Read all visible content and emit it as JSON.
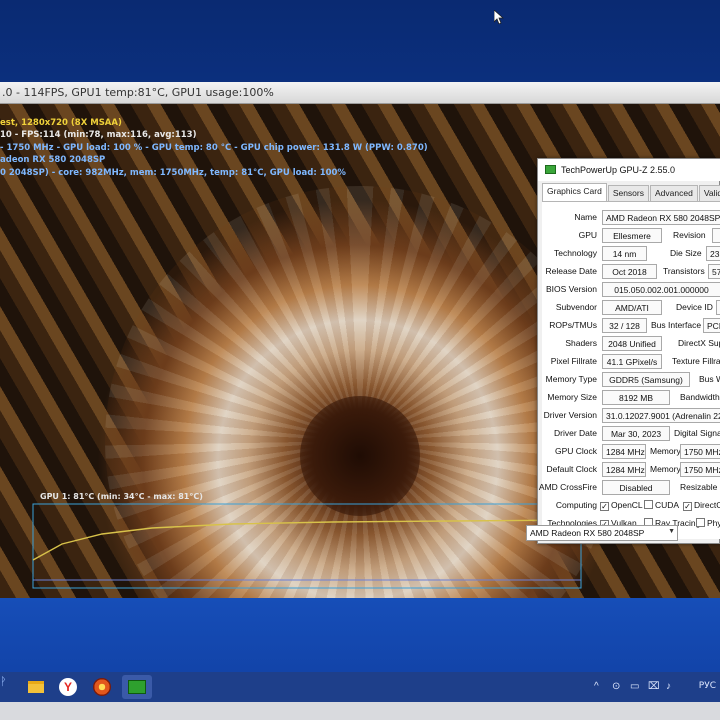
{
  "furmark": {
    "title": ".0 - 114FPS, GPU1 temp:81°C, GPU1 usage:100%",
    "osd": {
      "line1": "est, 1280x720 (8X MSAA)",
      "line2": "10 - FPS:114 (min:78, max:116, avg:113)",
      "line3": "- 1750 MHz - GPU load: 100 % - GPU temp: 80 °C - GPU chip power: 131.8 W (PPW: 0.870)",
      "line4": "adeon RX 580 2048SP",
      "line5": "0 2048SP) - core: 982MHz, mem: 1750MHz, temp: 81°C, GPU load: 100%"
    },
    "graph_label": "GPU 1: 81°C (min: 34°C - max: 81°C)"
  },
  "gpuz": {
    "title": "TechPowerUp GPU-Z 2.55.0",
    "tabs": [
      "Graphics Card",
      "Sensors",
      "Advanced",
      "Validation"
    ],
    "fields": {
      "name_label": "Name",
      "name_value": "AMD Radeon RX 580 2048SP",
      "gpu_label": "GPU",
      "gpu_value": "Ellesmere",
      "revision_label": "Revision",
      "technology_label": "Technology",
      "technology_value": "14 nm",
      "die_size_label": "Die Size",
      "die_size_value": "23",
      "release_date_label": "Release Date",
      "release_date_value": "Oct 2018",
      "transistors_label": "Transistors",
      "transistors_value": "57",
      "bios_label": "BIOS Version",
      "bios_value": "015.050.002.001.000000",
      "subvendor_label": "Subvendor",
      "subvendor_value": "AMD/ATI",
      "device_id_label": "Device ID",
      "rops_label": "ROPs/TMUs",
      "rops_value": "32 / 128",
      "bus_interface_label": "Bus Interface",
      "bus_interface_value": "PCIe",
      "shaders_label": "Shaders",
      "shaders_value": "2048 Unified",
      "directx_label": "DirectX Sup",
      "pixel_fillrate_label": "Pixel Fillrate",
      "pixel_fillrate_value": "41.1 GPixel/s",
      "texture_fillrate_label": "Texture Fillrate",
      "memory_type_label": "Memory Type",
      "memory_type_value": "GDDR5 (Samsung)",
      "bus_width_label": "Bus W",
      "memory_size_label": "Memory Size",
      "memory_size_value": "8192 MB",
      "bandwidth_label": "Bandwidth",
      "driver_version_label": "Driver Version",
      "driver_version_value": "31.0.12027.9001 (Adrenalin 22.20.27",
      "driver_date_label": "Driver Date",
      "driver_date_value": "Mar 30, 2023",
      "digital_signature_label": "Digital Signatur",
      "gpu_clock_label": "GPU Clock",
      "gpu_clock_value": "1284 MHz",
      "memory_clock_label": "Memory",
      "memory_clock_value": "1750 MHz",
      "default_clock_label": "Default Clock",
      "default_clock_value": "1284 MHz",
      "default_memory_label": "Memory",
      "default_memory_value": "1750 MHz",
      "crossfire_label": "AMD CrossFire",
      "crossfire_value": "Disabled",
      "resizable_bar_label": "Resizable BA",
      "computing_label": "Computing",
      "opencl_label": "OpenCL",
      "cuda_label": "CUDA",
      "directcompute_label": "DirectComp",
      "technologies_label": "Technologies",
      "vulkan_label": "Vulkan",
      "raytracing_label": "Ray Tracing",
      "physx_label": "PhysX"
    },
    "selected_gpu": "AMD Radeon RX 580 2048SP"
  },
  "taskbar": {
    "start_glyph": "ᚹ",
    "yandex_glyph": "Y",
    "tray_glyphs": [
      "^",
      "⊙",
      "▭",
      "⌧",
      "♪"
    ],
    "language": "РУС"
  },
  "colors": {
    "osd_yellow": "#f0d23a",
    "osd_blue": "#7fb8ff",
    "graph_line": "#d8c24a",
    "gpuz_icon": "#3aa63a"
  }
}
